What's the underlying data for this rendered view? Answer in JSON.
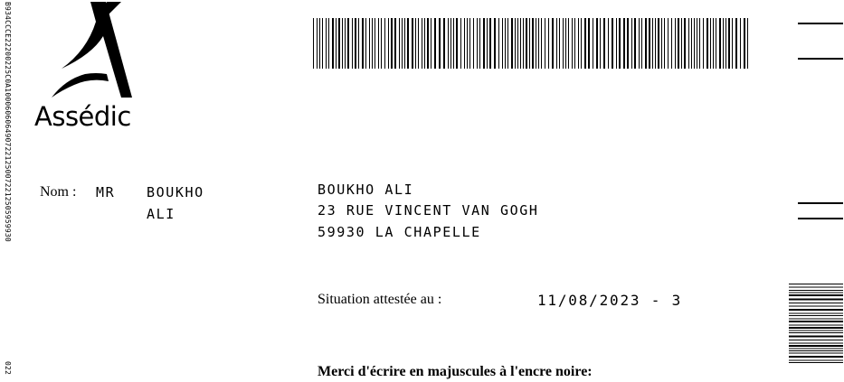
{
  "side_codes": {
    "top": "B934CCCE22200225C0A1000606064907221250072212505959930",
    "bottom": "022"
  },
  "logo": {
    "text": "Assédic",
    "icon": "assedic-a-logo-icon"
  },
  "name_section": {
    "label": "Nom :",
    "title": "MR",
    "last_name": "BOUKHO",
    "first_name": "ALI"
  },
  "address": {
    "line1": "BOUKHO ALI",
    "line2": "23 RUE VINCENT VAN GOGH",
    "line3": "59930 LA CHAPELLE"
  },
  "situation": {
    "label": "Situation attestée au :",
    "value": "11/08/2023 - 3"
  },
  "instruction": "Merci d'écrire en majuscules à l'encre noire:",
  "colors": {
    "ink": "#000000",
    "paper": "#ffffff"
  }
}
